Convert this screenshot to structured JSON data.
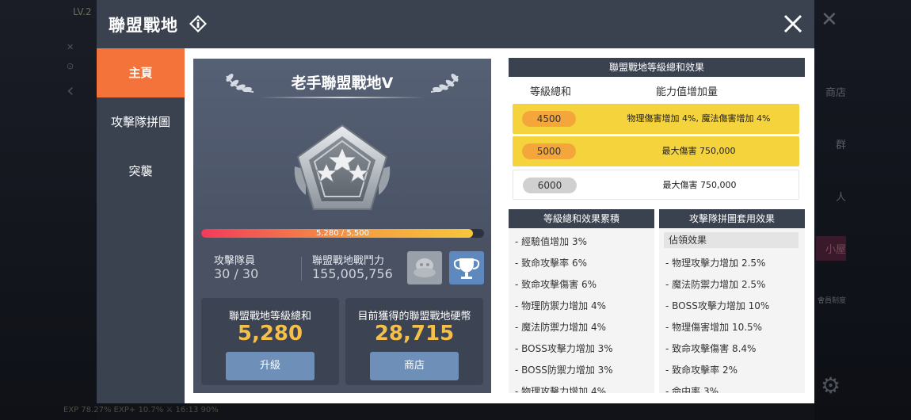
{
  "background": {
    "level": "LV.2",
    "menu_items": [
      "商店",
      "群",
      "人",
      "小屋",
      "會員制度"
    ],
    "status_bar": "EXP 78.27% EXP+ 10.7% ⚔ 16:13 90%"
  },
  "modal": {
    "title": "聯盟戰地",
    "close_label": "✕"
  },
  "nav": {
    "items": [
      {
        "label": "主頁",
        "active": true
      },
      {
        "label": "攻擊隊拼圖",
        "active": false
      },
      {
        "label": "突襲",
        "active": false
      }
    ]
  },
  "rank": {
    "title": "老手聯盟戰地V",
    "progress_text": "5,280 / 5,500",
    "progress_current": 5280,
    "progress_max": 5500
  },
  "stats": {
    "members_label": "攻擊隊員",
    "members_value": "30 / 30",
    "power_label": "聯盟戰地戰鬥力",
    "power_value": "155,005,756"
  },
  "level_box": {
    "label": "聯盟戰地等級總和",
    "value": "5,280",
    "button": "升級"
  },
  "coin_box": {
    "label": "目前獲得的聯盟戰地硬幣",
    "value": "28,715",
    "button": "商店"
  },
  "effects_table": {
    "header": "聯盟戰地等級總和效果",
    "col_level": "等級總和",
    "col_effect": "能力值增加量",
    "rows": [
      {
        "level": "4500",
        "effect": "物理傷害增加 4%, 魔法傷害增加 4%",
        "state": "gold"
      },
      {
        "level": "5000",
        "effect": "最大傷害 750,000",
        "state": "gold"
      },
      {
        "level": "6000",
        "effect": "最大傷害 750,000",
        "state": "white"
      }
    ]
  },
  "cumulative": {
    "header": "等級總和效果累積",
    "items": [
      "- 經驗值增加 3%",
      "- 致命攻擊率 6%",
      "- 致命攻擊傷害 6%",
      "- 物理防禦力增加 4%",
      "- 魔法防禦力增加 4%",
      "- BOSS攻擊力增加 3%",
      "- BOSS防禦力增加 3%",
      "- 物理攻擊力增加 4%"
    ]
  },
  "puzzle": {
    "header": "攻擊隊拼圖套用效果",
    "items": [
      "佔領效果",
      "- 物理攻擊力增加 2.5%",
      "- 魔法防禦力增加 2.5%",
      "- BOSS攻擊力增加 10%",
      "- 物理傷害增加 10.5%",
      "- 致命攻擊傷害 8.4%",
      "- 致命攻擊率 2%",
      "- 命中率 3%"
    ]
  },
  "colors": {
    "header_bg": "#3a414f",
    "nav_active": "#f3733a",
    "gold_row": "#f5d33c",
    "accent_value": "#f4c04a",
    "button_blue": "#6e8fb7"
  },
  "icons": [
    "info-icon",
    "close-icon",
    "laurel-icon",
    "rank-badge-icon",
    "squad-icon",
    "trophy-icon"
  ]
}
